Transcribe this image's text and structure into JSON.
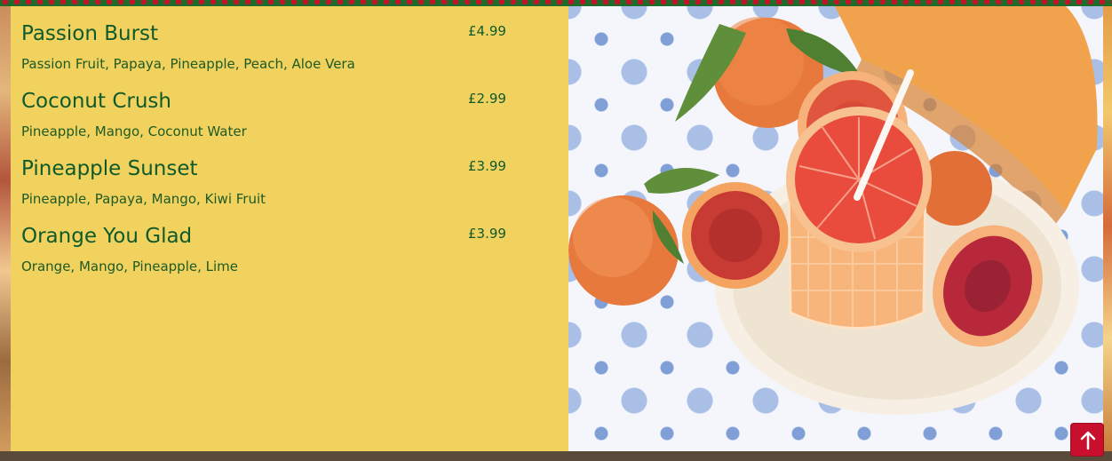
{
  "menu": {
    "items": [
      {
        "name": "Passion Burst",
        "price": "£4.99",
        "ingredients": "Passion Fruit, Papaya, Pineapple, Peach, Aloe Vera"
      },
      {
        "name": "Coconut Crush",
        "price": "£2.99",
        "ingredients": "Pineapple, Mango, Coconut Water"
      },
      {
        "name": "Pineapple Sunset",
        "price": "£3.99",
        "ingredients": "Pineapple, Papaya, Mango, Kiwi Fruit"
      },
      {
        "name": "Orange You Glad",
        "price": "£3.99",
        "ingredients": "Orange, Mango, Pineapple, Lime"
      }
    ]
  },
  "photo": {
    "icon": "blood-orange-juice-image"
  },
  "back_to_top": {
    "icon": "arrow-up-icon"
  },
  "colors": {
    "panel": "#f2d25e",
    "text": "#0f5a2a",
    "button": "#c8102e",
    "garland_green": "#1f6b2a",
    "garland_red": "#c4122b"
  }
}
